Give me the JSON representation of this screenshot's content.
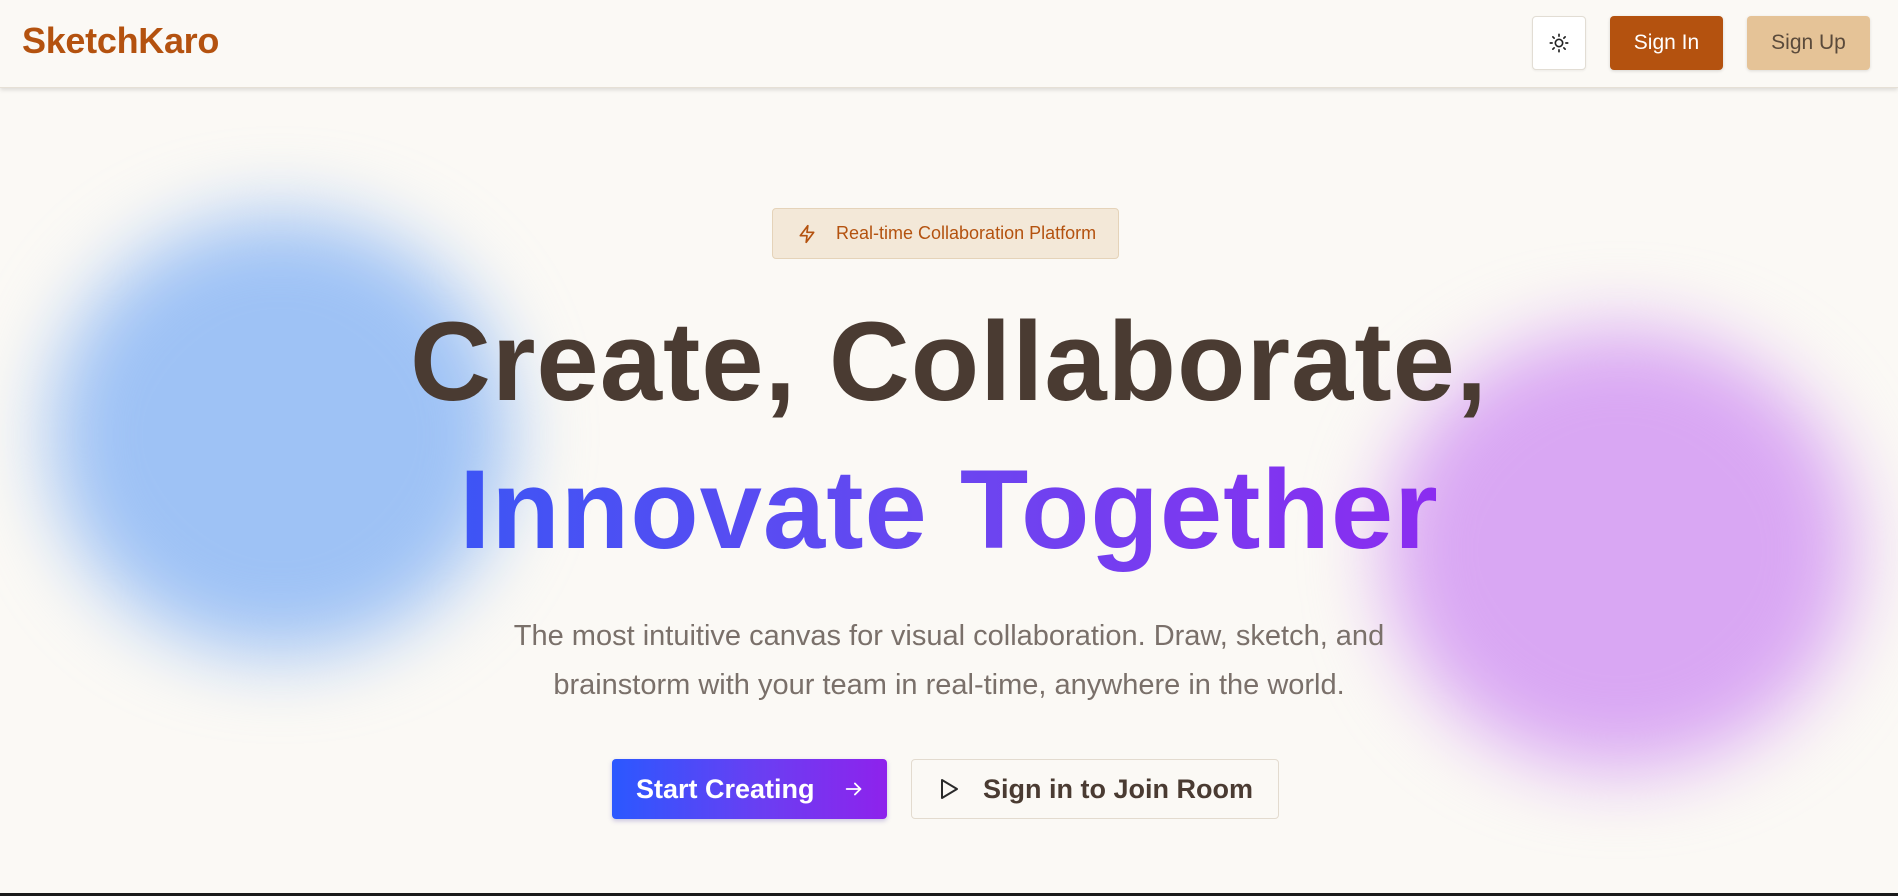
{
  "header": {
    "logo": "SketchKaro",
    "theme_toggle_icon": "sun-icon",
    "signin_label": "Sign In",
    "signup_label": "Sign Up"
  },
  "hero": {
    "badge_icon": "lightning-icon",
    "badge_text": "Real-time Collaboration Platform",
    "headline_line1": "Create, Collaborate,",
    "headline_line2": "Innovate Together",
    "subtitle_line1": "The most intuitive canvas for visual collaboration. Draw, sketch, and",
    "subtitle_line2": "brainstorm with your team in real-time, anywhere in the world.",
    "primary_cta": "Start Creating",
    "primary_cta_icon": "arrow-right-icon",
    "secondary_cta": "Sign in to Join Room",
    "secondary_cta_icon": "play-icon"
  },
  "colors": {
    "brand": "#b4520f",
    "signup_bg": "#e5c397",
    "heading": "#4a3b32",
    "gradient_start": "#3d55f5",
    "gradient_end": "#8b2cf0",
    "background": "#fbf9f5"
  }
}
